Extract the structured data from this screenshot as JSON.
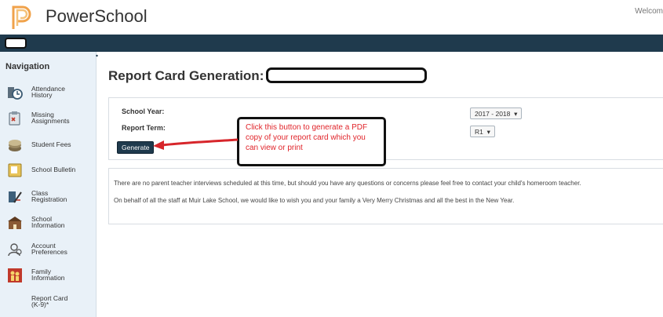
{
  "header": {
    "brand": "PowerSchool",
    "welcome": "Welcom"
  },
  "sidebar": {
    "title": "Navigation",
    "items": [
      {
        "label_line1": "Attendance",
        "label_line2": "History",
        "icon": "clock-icon"
      },
      {
        "label_line1": "Missing",
        "label_line2": "Assignments",
        "icon": "clipboard-icon"
      },
      {
        "label_line1": "Student Fees",
        "label_line2": "",
        "icon": "coins-icon"
      },
      {
        "label_line1": "School Bulletin",
        "label_line2": "",
        "icon": "bulletin-icon"
      },
      {
        "label_line1": "Class",
        "label_line2": "Registration",
        "icon": "registration-icon"
      },
      {
        "label_line1": "School",
        "label_line2": "Information",
        "icon": "school-icon"
      },
      {
        "label_line1": "Account",
        "label_line2": "Preferences",
        "icon": "account-icon"
      },
      {
        "label_line1": "Family",
        "label_line2": "Information",
        "icon": "family-icon"
      },
      {
        "label_line1": "Report Card",
        "label_line2": "(K-9)*",
        "icon": ""
      }
    ]
  },
  "main": {
    "title": "Report Card Generation:",
    "form": {
      "school_year_label": "School Year:",
      "school_year_value": "2017 - 2018",
      "report_term_label": "Report Term:",
      "report_term_value": "R1",
      "generate_label": "Generate"
    },
    "callout": "Click this button to generate a PDF copy of your report card which you can view or print",
    "messages": [
      "There are no parent teacher interviews scheduled at this time, but should you have any questions or concerns please feel free to contact your child's homeroom teacher.",
      "On behalf of all the staff at Muir Lake School, we would like to wish you and your family a Very Merry Christmas and all the best in the New Year."
    ]
  },
  "colors": {
    "brand_dark": "#1f3a4d",
    "sidebar_bg": "#e9f1f8",
    "callout_text": "#e0242a",
    "arrow": "#d7262b"
  }
}
